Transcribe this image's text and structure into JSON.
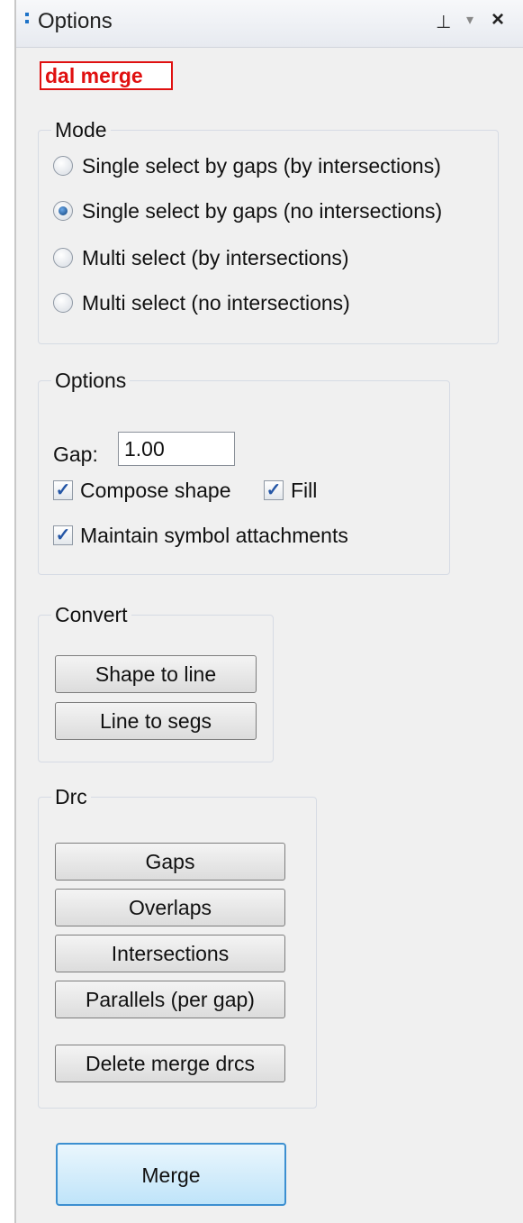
{
  "window": {
    "title": "Options",
    "pin_icon": "⊥",
    "dropdown_icon": "▾",
    "close_icon": "×"
  },
  "plugin_label": "dal merge",
  "mode": {
    "legend": "Mode",
    "options": [
      {
        "label": "Single select by gaps (by intersections)",
        "selected": false
      },
      {
        "label": "Single select by gaps (no intersections)",
        "selected": true
      },
      {
        "label": "Multi select (by intersections)",
        "selected": false
      },
      {
        "label": "Multi select (no intersections)",
        "selected": false
      }
    ]
  },
  "options": {
    "legend": "Options",
    "gap_label": "Gap:",
    "gap_value": "1.00",
    "compose_shape": {
      "label": "Compose shape",
      "checked": true
    },
    "fill": {
      "label": "Fill",
      "checked": true
    },
    "maintain_symbols": {
      "label": "Maintain symbol attachments",
      "checked": true
    }
  },
  "convert": {
    "legend": "Convert",
    "shape_to_line": "Shape to line",
    "line_to_segs": "Line to segs"
  },
  "drc": {
    "legend": "Drc",
    "gaps": "Gaps",
    "overlaps": "Overlaps",
    "intersections": "Intersections",
    "parallels": "Parallels (per gap)",
    "delete_merge_drcs": "Delete merge drcs"
  },
  "merge_button": "Merge",
  "colors": {
    "label_red": "#e01010",
    "merge_button_border": "#3c8fd0",
    "radio_selected": "#0c3f7a"
  }
}
